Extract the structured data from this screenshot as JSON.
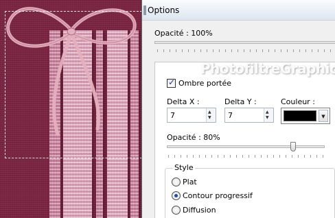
{
  "dialog": {
    "title": "Options",
    "opacity_label": "Opacité : 100%"
  },
  "watermark": "PhotofiltreGraphic",
  "shadow": {
    "checkbox_label": "Ombre portée",
    "checked": true,
    "delta_x_label": "Delta X :",
    "delta_x_value": "7",
    "delta_y_label": "Delta Y :",
    "delta_y_value": "7",
    "color_label": "Couleur :",
    "color_value": "#000000",
    "opacity_label": "Opacité : 80%",
    "opacity_level": 0.8
  },
  "style": {
    "group_label": "Style",
    "options": [
      {
        "label": "Plat",
        "selected": false
      },
      {
        "label": "Contour progressif",
        "selected": true
      },
      {
        "label": "Diffusion",
        "selected": false
      }
    ]
  }
}
